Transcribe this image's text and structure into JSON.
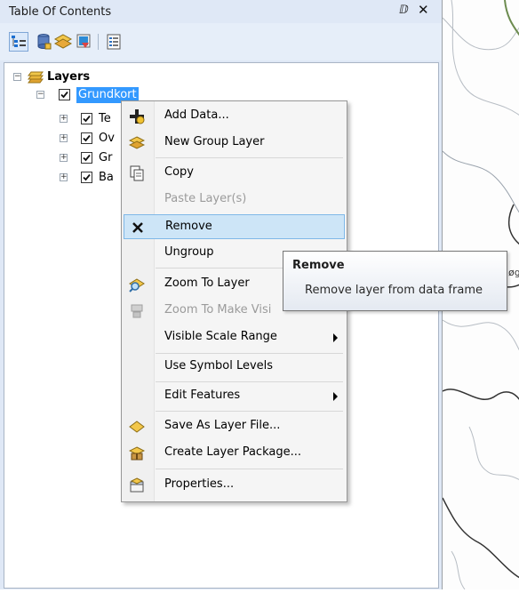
{
  "toc": {
    "title": "Table Of Contents",
    "pin_glyph": "ⅅ",
    "close_glyph": "✕",
    "toolbar": [
      "list-by-drawing-order-icon",
      "list-by-source-icon",
      "list-by-visibility-icon",
      "list-by-selection-icon",
      "options-icon"
    ]
  },
  "tree": {
    "root": {
      "label": "Layers",
      "expander": "−",
      "icon": "layers-icon"
    },
    "group": {
      "label": "Grundkort",
      "expander": "−",
      "checked": true
    },
    "children": [
      {
        "label": "Te",
        "expander": "+",
        "checked": true
      },
      {
        "label": "Ov",
        "expander": "+",
        "checked": true
      },
      {
        "label": "Gr",
        "expander": "+",
        "checked": true
      },
      {
        "label": "Ba",
        "expander": "+",
        "checked": true
      }
    ]
  },
  "context_menu": {
    "items": [
      {
        "label": "Add Data...",
        "icon": "add-data-icon",
        "enabled": true
      },
      {
        "label": "New Group Layer",
        "icon": "group-layer-icon",
        "enabled": true
      },
      {
        "label": "Copy",
        "icon": "copy-icon",
        "enabled": true
      },
      {
        "label": "Paste Layer(s)",
        "icon": "",
        "enabled": false
      },
      {
        "label": "Remove",
        "icon": "remove-icon",
        "enabled": true,
        "highlighted": true
      },
      {
        "label": "Ungroup",
        "icon": "",
        "enabled": true
      },
      {
        "label": "Zoom To Layer",
        "icon": "zoom-to-layer-icon",
        "enabled": true
      },
      {
        "label": "Zoom To Make Visi",
        "icon": "zoom-to-visible-icon",
        "enabled": false
      },
      {
        "label": "Visible Scale Range",
        "icon": "",
        "enabled": true,
        "submenu": true
      },
      {
        "label": "Use Symbol Levels",
        "icon": "",
        "enabled": true
      },
      {
        "label": "Edit Features",
        "icon": "",
        "enabled": true,
        "submenu": true
      },
      {
        "label": "Save As Layer File...",
        "icon": "save-layer-icon",
        "enabled": true
      },
      {
        "label": "Create Layer Package...",
        "icon": "layer-package-icon",
        "enabled": true
      },
      {
        "label": "Properties...",
        "icon": "properties-icon",
        "enabled": true
      }
    ]
  },
  "tooltip": {
    "title": "Remove",
    "text": "Remove layer from data frame"
  },
  "map": {
    "visible_fragment": "øg"
  },
  "colors": {
    "selection": "#3399ff",
    "menu_highlight": "#cde5f7",
    "panel": "#dfe8f6"
  }
}
